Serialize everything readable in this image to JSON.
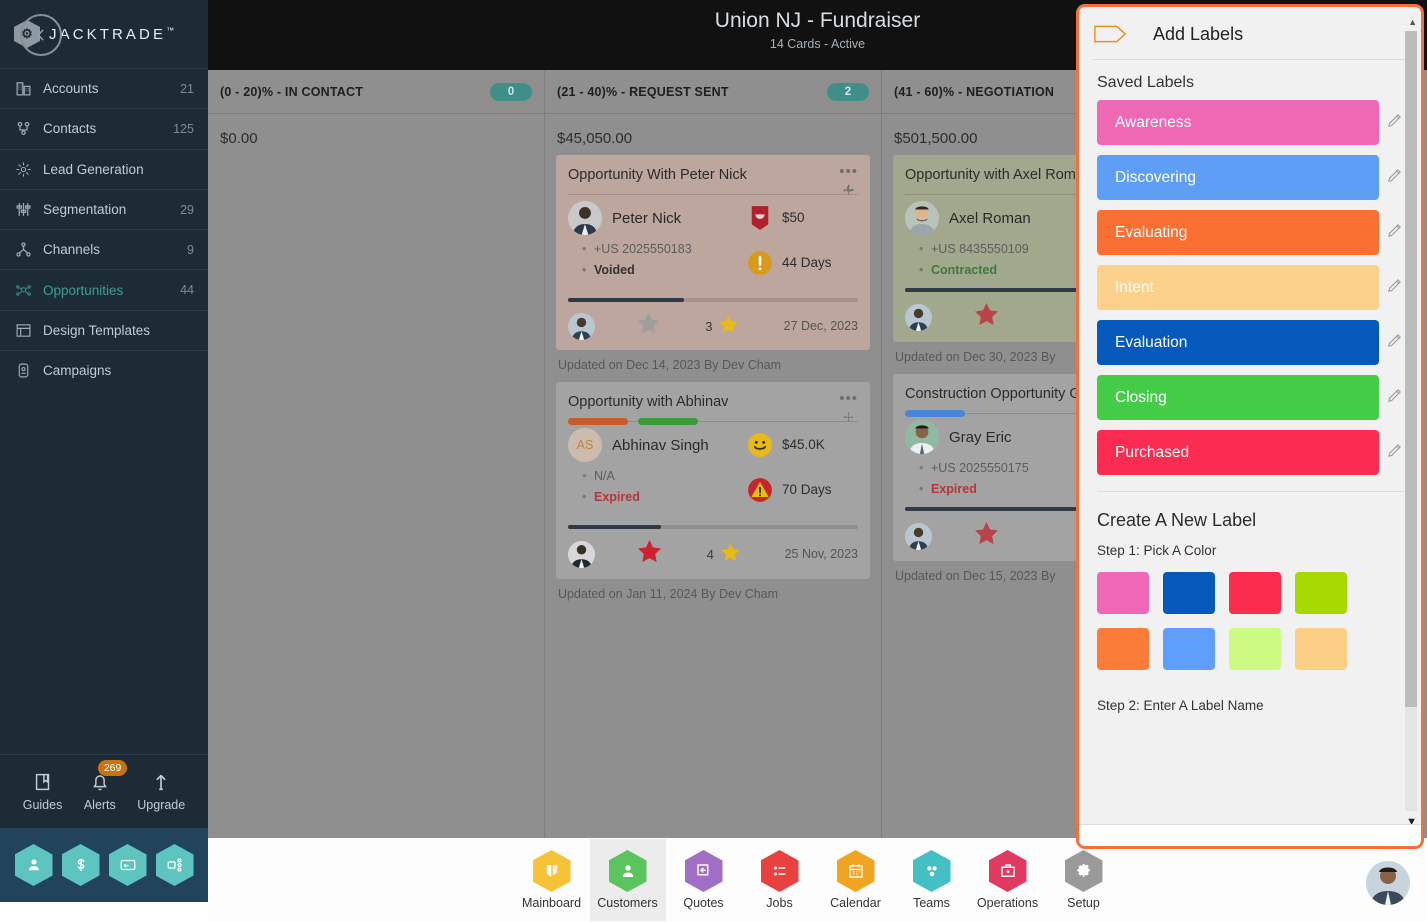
{
  "sidebar": {
    "logo": "JACKTRADE",
    "logo_tm": "™",
    "items": [
      {
        "label": "Accounts",
        "count": "21",
        "icon": "building-icon"
      },
      {
        "label": "Contacts",
        "count": "125",
        "icon": "contacts-icon"
      },
      {
        "label": "Lead Generation",
        "count": "",
        "icon": "lead-generation-icon"
      },
      {
        "label": "Segmentation",
        "count": "29",
        "icon": "segmentation-icon"
      },
      {
        "label": "Channels",
        "count": "9",
        "icon": "channels-icon"
      },
      {
        "label": "Opportunities",
        "count": "44",
        "icon": "opportunities-icon"
      },
      {
        "label": "Design Templates",
        "count": "",
        "icon": "design-templates-icon"
      },
      {
        "label": "Campaigns",
        "count": "",
        "icon": "campaigns-icon"
      }
    ],
    "utils": [
      {
        "label": "Guides",
        "badge": ""
      },
      {
        "label": "Alerts",
        "badge": "269"
      },
      {
        "label": "Upgrade",
        "badge": ""
      }
    ],
    "quick_actions": [
      "person-hex-icon",
      "dollar-hex-icon",
      "payment-hex-icon",
      "workflow-hex-icon"
    ]
  },
  "header": {
    "back_icon": "chevron-left-icon",
    "title": "Union NJ - Fundraiser",
    "subtitle": "14 Cards - Active",
    "next_icon": "chevron-right-icon"
  },
  "board": {
    "columns": [
      {
        "title": "(0 - 20)% - IN CONTACT",
        "count": "0",
        "total": "$0.00",
        "cards": []
      },
      {
        "title": "(21 - 40)% - REQUEST SENT",
        "count": "2",
        "total": "$45,050.00",
        "cards": [
          {
            "title": "Opportunity With Peter Nick",
            "theme": "rose",
            "label_bars": [],
            "person": "Peter Nick",
            "avatar_initials": "",
            "phone": "+US 2025550183",
            "status": "Voided",
            "status_color": "dark",
            "amount": "$50",
            "amount_icon": "shield-badge-icon",
            "days": "44 Days",
            "days_icon": "warning-circle-icon",
            "progress": 40,
            "star_left": "star-grey",
            "star_count": "3",
            "star_right": "star-gold",
            "date": "27 Dec, 2023",
            "updated": "Updated on Dec 14, 2023 By Dev Cham"
          },
          {
            "title": "Opportunity with Abhinav",
            "theme": "grey",
            "label_bars": [
              "#c75b2e",
              "#3a9a3a"
            ],
            "person": "Abhinav Singh",
            "avatar_initials": "AS",
            "phone": "N/A",
            "status": "Expired",
            "status_color": "red",
            "amount": "$45.0K",
            "amount_icon": "smiley-icon",
            "days": "70 Days",
            "days_icon": "warning-triangle-icon",
            "progress": 32,
            "star_left": "star-red",
            "star_count": "4",
            "star_right": "star-gold",
            "date": "25 Nov, 2023",
            "updated": "Updated on Jan 11, 2024 By Dev Cham"
          }
        ]
      },
      {
        "title": "(41 - 60)% - NEGOTIATION",
        "count": "",
        "total": "$501,500.00",
        "cards": [
          {
            "title": "Opportunity with Axel Roman",
            "theme": "olive",
            "label_bars": [],
            "person": "Axel Roman",
            "avatar_initials": "",
            "phone": "+US 8435550109",
            "status": "Contracted",
            "status_color": "green",
            "amount": "",
            "amount_icon": "",
            "days": "",
            "days_icon": "",
            "progress": 100,
            "star_left": "star-red",
            "star_count": "3",
            "star_right": "star-gold",
            "date": "",
            "updated": "Updated on Dec 30, 2023 By"
          },
          {
            "title": "Construction Opportunity Gray Eric",
            "theme": "grey2",
            "label_bars": [
              "#4b86d6"
            ],
            "person": "Gray Eric",
            "avatar_initials": "",
            "phone": "+US 2025550175",
            "status": "Expired",
            "status_color": "red",
            "amount": "",
            "amount_icon": "",
            "days": "",
            "days_icon": "",
            "progress": 100,
            "star_left": "star-red",
            "star_count": "4",
            "star_right": "star-gold",
            "date": "",
            "updated": "Updated on Dec 15, 2023 By"
          }
        ]
      }
    ]
  },
  "labels_panel": {
    "tag_icon": "tag-icon",
    "title": "Add Labels",
    "saved_heading": "Saved Labels",
    "edit_icon": "pencil-icon",
    "saved_labels": [
      {
        "name": "Awareness",
        "color": "#ee68b4"
      },
      {
        "name": "Discovering",
        "color": "#5f9ef7"
      },
      {
        "name": "Evaluating",
        "color": "#fa7033"
      },
      {
        "name": "Intent",
        "color": "#fcd18c"
      },
      {
        "name": "Evaluation",
        "color": "#0459bb"
      },
      {
        "name": "Closing",
        "color": "#44cc49"
      },
      {
        "name": "Purchased",
        "color": "#fb2c52"
      }
    ],
    "create_heading": "Create A New Label",
    "step1": "Step 1: Pick A Color",
    "palette": [
      "#ef68b8",
      "#0459bb",
      "#fb2c4e",
      "#a8d802",
      "#fb7b38",
      "#5f9efb",
      "#cbfb82",
      "#fccf87"
    ],
    "step2": "Step 2: Enter A Label Name",
    "scroll_up_icon": "scroll-up-arrow",
    "scroll_down_icon": "scroll-down-arrow"
  },
  "bottom_nav": {
    "items": [
      {
        "label": "Mainboard",
        "color": "#f6c338",
        "icon": "mainboard-icon",
        "selected": false
      },
      {
        "label": "Customers",
        "color": "#5cc45f",
        "icon": "customers-icon",
        "selected": true
      },
      {
        "label": "Quotes",
        "color": "#a06fc5",
        "icon": "quotes-icon",
        "selected": false
      },
      {
        "label": "Jobs",
        "color": "#e94040",
        "icon": "jobs-icon",
        "selected": false
      },
      {
        "label": "Calendar",
        "color": "#f0a520",
        "icon": "calendar-icon",
        "selected": false
      },
      {
        "label": "Teams",
        "color": "#44bfc4",
        "icon": "teams-icon",
        "selected": false
      },
      {
        "label": "Operations",
        "color": "#e03a63",
        "icon": "operations-icon",
        "selected": false
      },
      {
        "label": "Setup",
        "color": "#9a9a9a",
        "icon": "setup-gear-icon",
        "selected": false
      }
    ],
    "user_avatar": "user-avatar"
  }
}
